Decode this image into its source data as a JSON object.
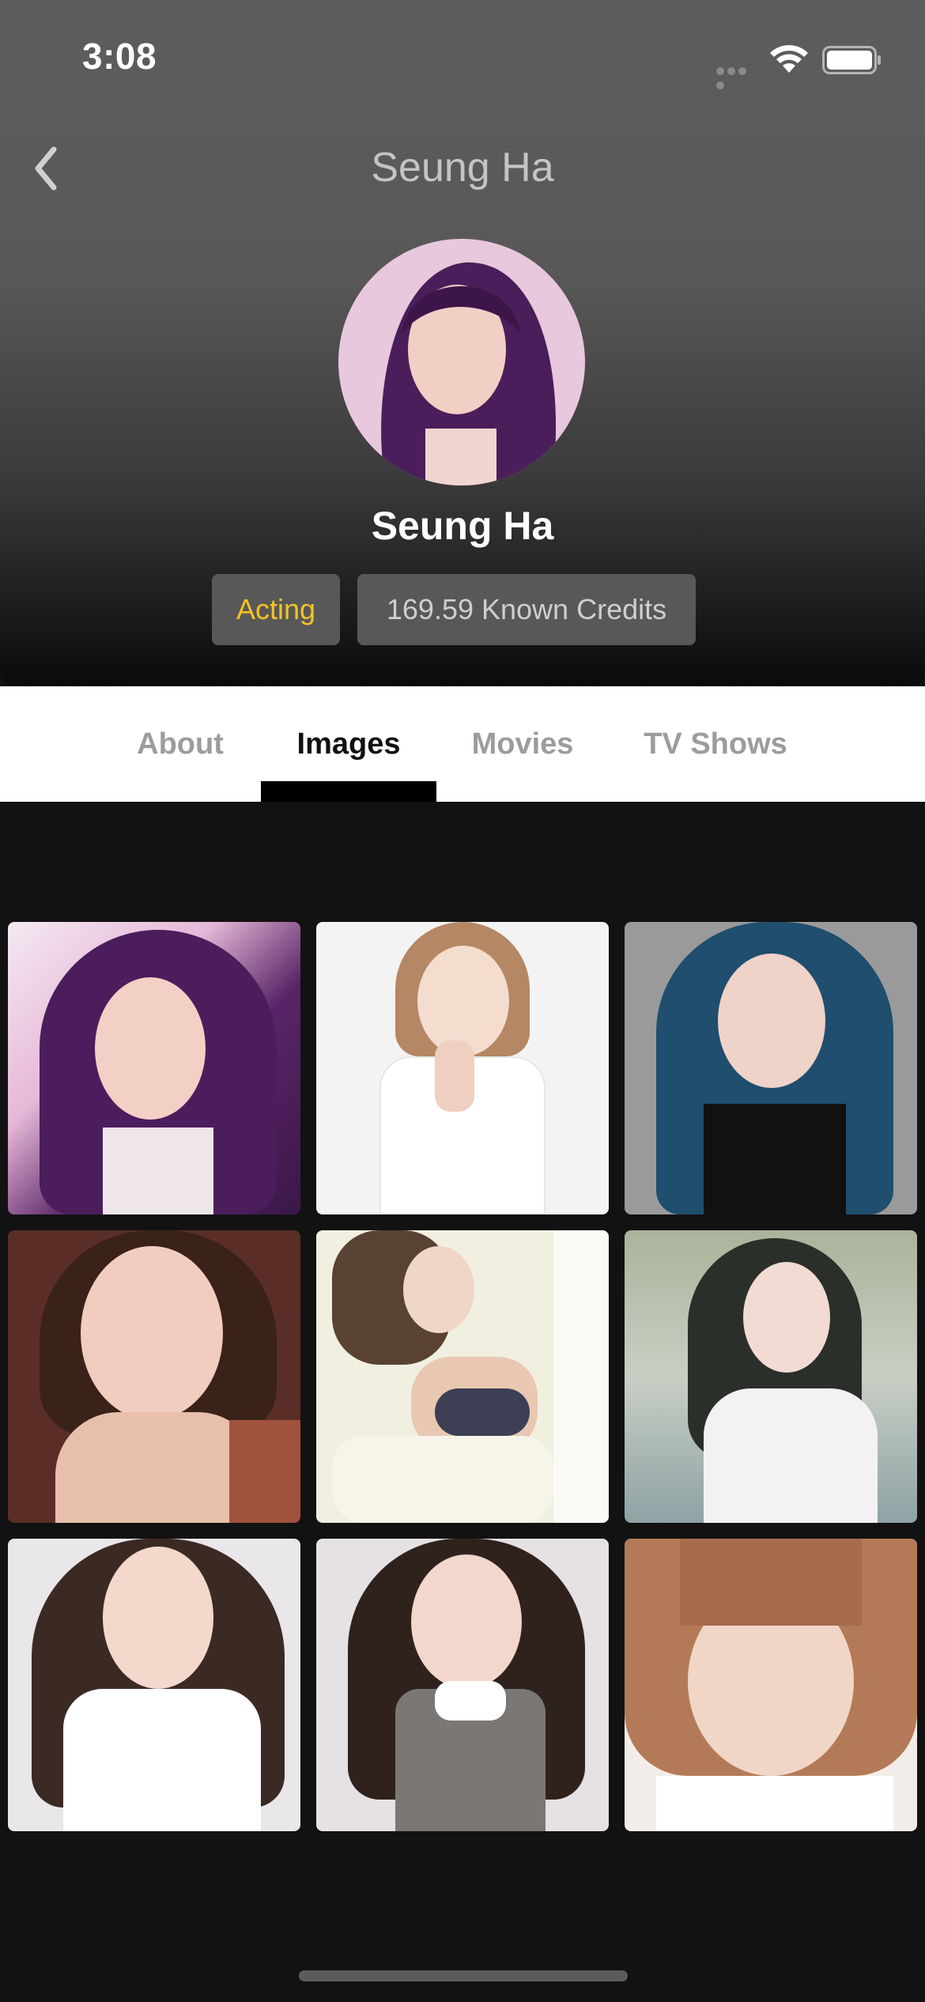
{
  "status_bar": {
    "time": "3:08"
  },
  "nav": {
    "title": "Seung Ha",
    "back_icon": "chevron-left-icon"
  },
  "profile": {
    "name": "Seung Ha",
    "department_badge": "Acting",
    "credits_badge": "169.59 Known Credits"
  },
  "tabs": [
    {
      "label": "About",
      "active": false
    },
    {
      "label": "Images",
      "active": true
    },
    {
      "label": "Movies",
      "active": false
    },
    {
      "label": "TV Shows",
      "active": false
    }
  ],
  "images": {
    "count": 9
  },
  "colors": {
    "accent": "#f3c323",
    "badge_bg": "#585858",
    "background": "#121212",
    "tab_active": "#111111",
    "tab_inactive": "#9c9c9c"
  }
}
